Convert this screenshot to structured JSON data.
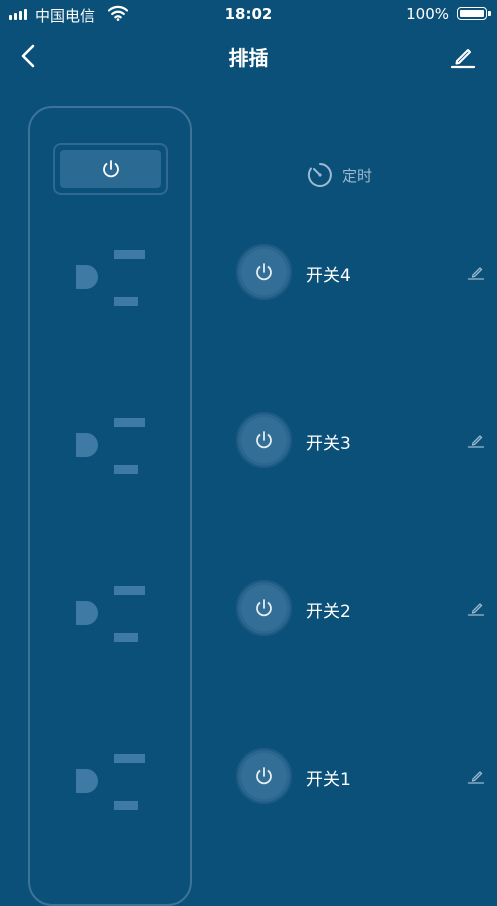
{
  "status_bar": {
    "carrier": "中国电信",
    "time": "18:02",
    "battery": "100%"
  },
  "header": {
    "title": "排插"
  },
  "timer": {
    "label": "定时"
  },
  "switches": [
    {
      "name": "开关4"
    },
    {
      "name": "开关3"
    },
    {
      "name": "开关2"
    },
    {
      "name": "开关1"
    }
  ],
  "colors": {
    "background": "#0b5079",
    "strip_outline": "#3d7399",
    "socket": "#3e7aa3",
    "power_button": "#2a6690",
    "muted_text": "#9cb9cf"
  },
  "icons": {
    "back": "chevron-left-icon",
    "edit": "pencil-icon",
    "power": "power-icon",
    "timer": "timer-icon",
    "rename": "pencil-icon"
  }
}
